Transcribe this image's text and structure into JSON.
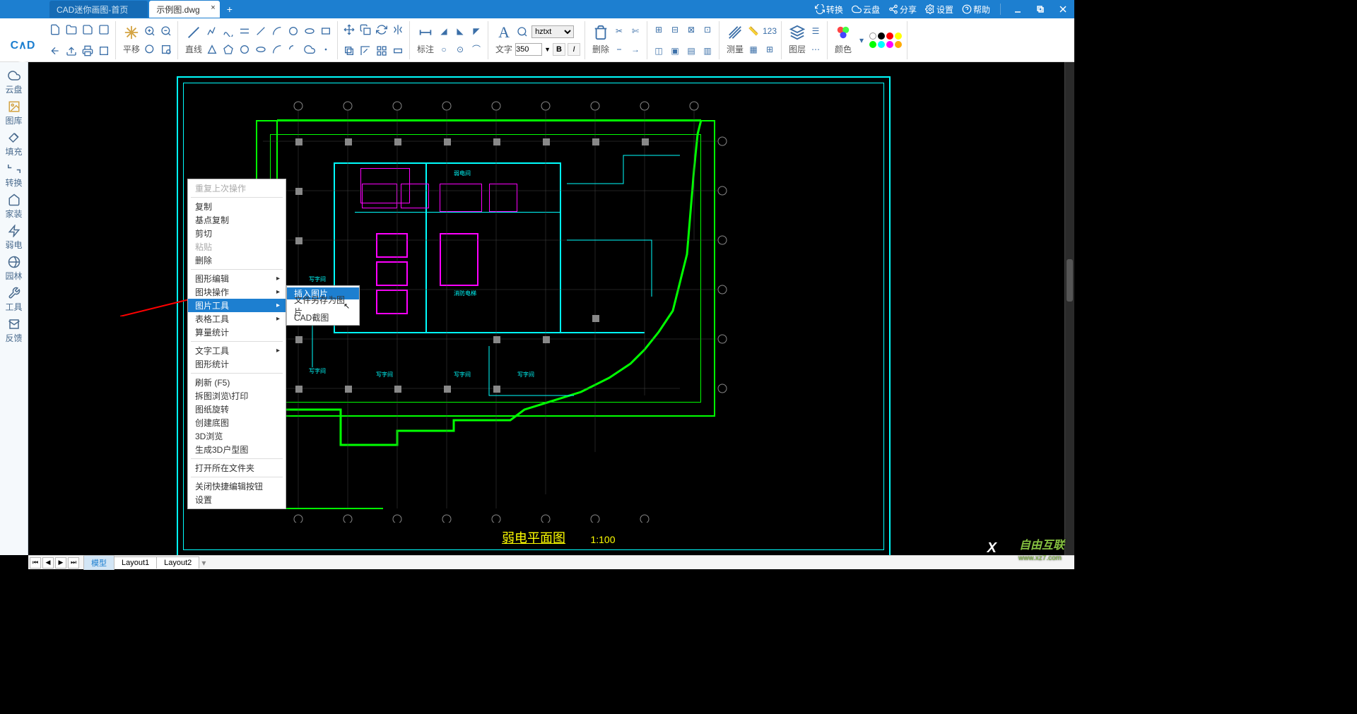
{
  "titlebar": {
    "tabs": [
      {
        "label": "CAD迷你画图-首页",
        "active": false
      },
      {
        "label": "示例图.dwg",
        "active": true
      }
    ],
    "links": {
      "convert": "转换",
      "cloud": "云盘",
      "share": "分享",
      "settings": "设置",
      "help": "帮助"
    }
  },
  "ribbon": {
    "pan": "平移",
    "line": "直线",
    "dim": "标注",
    "text": "文字",
    "del": "删除",
    "measure": "测量",
    "layer": "图层",
    "color": "颜色",
    "font_name": "hztxt",
    "font_size": "350",
    "bold": "B",
    "italic": "I"
  },
  "sidebar": {
    "items": [
      {
        "id": "cloud",
        "label": "云盘"
      },
      {
        "id": "gallery",
        "label": "图库"
      },
      {
        "id": "fill",
        "label": "填充"
      },
      {
        "id": "convert",
        "label": "转换"
      },
      {
        "id": "house",
        "label": "家装"
      },
      {
        "id": "elec",
        "label": "弱电"
      },
      {
        "id": "land",
        "label": "园林"
      },
      {
        "id": "tools",
        "label": "工具"
      },
      {
        "id": "feedback",
        "label": "反馈"
      }
    ]
  },
  "drawing": {
    "title": "弱电平面图",
    "scale": "1:100"
  },
  "context_menu": {
    "repeat": "重复上次操作",
    "copy": "复制",
    "basecopy": "基点复制",
    "cut": "剪切",
    "paste": "粘贴",
    "delete": "删除",
    "shape_edit": "图形编辑",
    "block_ops": "图块操作",
    "image_tools": "图片工具",
    "table_tools": "表格工具",
    "calc": "算量统计",
    "text_tools": "文字工具",
    "shape_stats": "图形统计",
    "refresh": "刷新 (F5)",
    "browse_print": "拆图浏览\\打印",
    "rotate": "图纸旋转",
    "create_base": "创建底图",
    "view3d": "3D浏览",
    "gen3d": "生成3D户型图",
    "open_folder": "打开所在文件夹",
    "close_shortcut": "关闭快捷编辑按钮",
    "settings": "设置"
  },
  "submenu": {
    "insert_image": "插入图片",
    "save_as_image": "文件另存为图片",
    "cad_snip": "CAD截图"
  },
  "bottom": {
    "model": "模型",
    "layout1": "Layout1",
    "layout2": "Layout2"
  },
  "watermark": {
    "main": "自由互联",
    "sub": "www.xz7.com",
    "x": "X"
  }
}
